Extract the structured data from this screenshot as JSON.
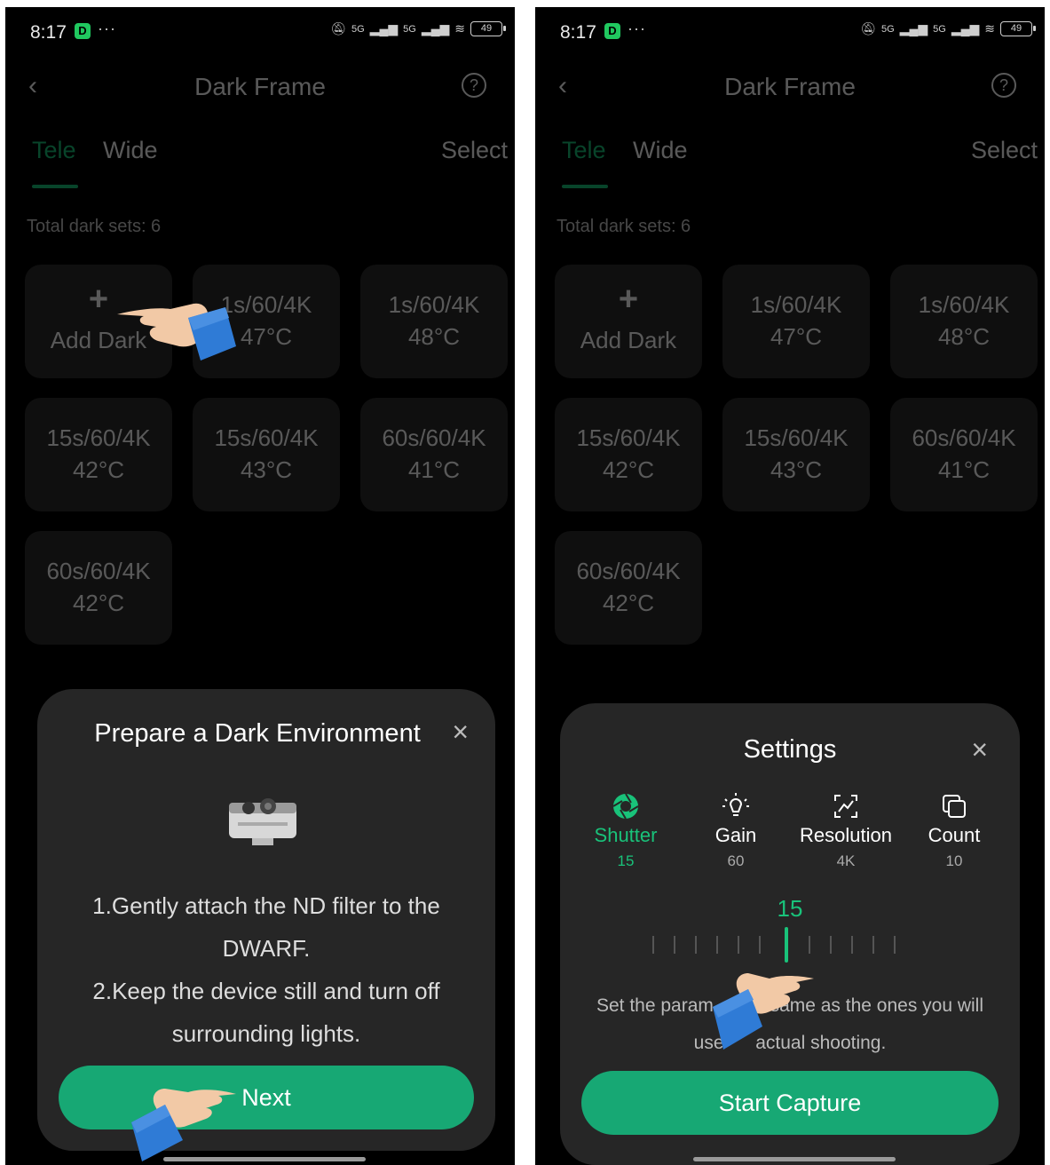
{
  "status": {
    "time": "8:17",
    "app_badge": "D",
    "dots": "···",
    "battery": "49",
    "signal1": "5G",
    "signal2": "5G"
  },
  "header": {
    "title": "Dark Frame",
    "back_icon": "chevron-left-icon",
    "help_icon": "question-circle-icon"
  },
  "tabs": [
    {
      "label": "Tele",
      "active": true
    },
    {
      "label": "Wide",
      "active": false
    }
  ],
  "select_label": "Select",
  "total_label": "Total dark sets: 6",
  "add_card": {
    "plus": "+",
    "label": "Add Dark"
  },
  "cards": [
    {
      "line1": "1s/60/4K",
      "line2": "47°C"
    },
    {
      "line1": "1s/60/4K",
      "line2": "48°C"
    },
    {
      "line1": "15s/60/4K",
      "line2": "42°C"
    },
    {
      "line1": "15s/60/4K",
      "line2": "43°C"
    },
    {
      "line1": "60s/60/4K",
      "line2": "41°C"
    },
    {
      "line1": "60s/60/4K",
      "line2": "42°C"
    }
  ],
  "left_sheet": {
    "title": "Prepare a Dark Environment",
    "close": "×",
    "instr_lines": [
      "1.Gently attach the ND filter to the",
      "DWARF.",
      "2.Keep the device still and turn off",
      "surrounding lights."
    ],
    "button": "Next"
  },
  "right_sheet": {
    "title": "Settings",
    "close": "×",
    "params": [
      {
        "name": "Shutter",
        "value": "15",
        "icon": "shutter-icon",
        "active": true
      },
      {
        "name": "Gain",
        "value": "60",
        "icon": "bulb-icon",
        "active": false
      },
      {
        "name": "Resolution",
        "value": "4K",
        "icon": "resolution-icon",
        "active": false
      },
      {
        "name": "Count",
        "value": "10",
        "icon": "copy-icon",
        "active": false
      }
    ],
    "slider_value": "15",
    "hint_line1": "Set the param",
    "hint_line1b": "same as the ones you will",
    "hint_line2a": "use ",
    "hint_line2b": "actual shooting.",
    "button": "Start Capture"
  },
  "colors": {
    "accent": "#19c27a",
    "button": "#17a874",
    "sheet": "#262626",
    "card": "#2b2b2b",
    "background": "#000000"
  }
}
